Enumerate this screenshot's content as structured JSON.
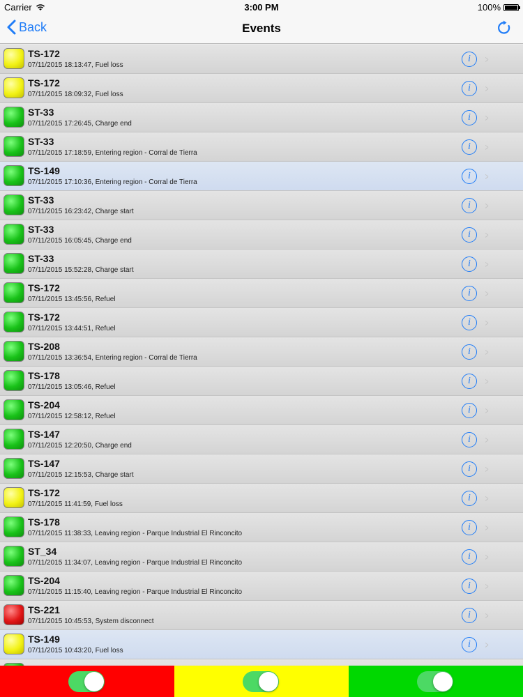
{
  "status_bar": {
    "carrier": "Carrier",
    "time": "3:00 PM",
    "battery": "100%"
  },
  "nav": {
    "back_label": "Back",
    "title": "Events",
    "accent_color": "#1f7cf7"
  },
  "events": [
    {
      "name": "TS-172",
      "detail": "07/11/2015 18:13:47, Fuel loss",
      "status": "yellow",
      "highlighted": false
    },
    {
      "name": "TS-172",
      "detail": "07/11/2015 18:09:32, Fuel loss",
      "status": "yellow",
      "highlighted": false
    },
    {
      "name": "ST-33",
      "detail": "07/11/2015 17:26:45, Charge end",
      "status": "green",
      "highlighted": false
    },
    {
      "name": "ST-33",
      "detail": "07/11/2015 17:18:59, Entering region - Corral de Tierra",
      "status": "green",
      "highlighted": false
    },
    {
      "name": "TS-149",
      "detail": "07/11/2015 17:10:36, Entering region - Corral de Tierra",
      "status": "green",
      "highlighted": true
    },
    {
      "name": "ST-33",
      "detail": "07/11/2015 16:23:42, Charge start",
      "status": "green",
      "highlighted": false
    },
    {
      "name": "ST-33",
      "detail": "07/11/2015 16:05:45, Charge end",
      "status": "green",
      "highlighted": false
    },
    {
      "name": "ST-33",
      "detail": "07/11/2015 15:52:28, Charge start",
      "status": "green",
      "highlighted": false
    },
    {
      "name": "TS-172",
      "detail": "07/11/2015 13:45:56, Refuel",
      "status": "green",
      "highlighted": false
    },
    {
      "name": "TS-172",
      "detail": "07/11/2015 13:44:51, Refuel",
      "status": "green",
      "highlighted": false
    },
    {
      "name": "TS-208",
      "detail": "07/11/2015 13:36:54, Entering region - Corral de Tierra",
      "status": "green",
      "highlighted": false
    },
    {
      "name": "TS-178",
      "detail": "07/11/2015 13:05:46, Refuel",
      "status": "green",
      "highlighted": false
    },
    {
      "name": "TS-204",
      "detail": "07/11/2015 12:58:12, Refuel",
      "status": "green",
      "highlighted": false
    },
    {
      "name": "TS-147",
      "detail": "07/11/2015 12:20:50, Charge end",
      "status": "green",
      "highlighted": false
    },
    {
      "name": "TS-147",
      "detail": "07/11/2015 12:15:53, Charge start",
      "status": "green",
      "highlighted": false
    },
    {
      "name": "TS-172",
      "detail": "07/11/2015 11:41:59, Fuel loss",
      "status": "yellow",
      "highlighted": false
    },
    {
      "name": "TS-178",
      "detail": "07/11/2015 11:38:33, Leaving region - Parque Industrial El Rinconcito",
      "status": "green",
      "highlighted": false
    },
    {
      "name": "ST_34",
      "detail": "07/11/2015 11:34:07, Leaving region - Parque Industrial El Rinconcito",
      "status": "green",
      "highlighted": false
    },
    {
      "name": "TS-204",
      "detail": "07/11/2015 11:15:40, Leaving region - Parque Industrial El Rinconcito",
      "status": "green",
      "highlighted": false
    },
    {
      "name": "TS-221",
      "detail": "07/11/2015 10:45:53, System disconnect",
      "status": "red",
      "highlighted": false
    },
    {
      "name": "TS-149",
      "detail": "07/11/2015 10:43:20, Fuel loss",
      "status": "yellow",
      "highlighted": true
    },
    {
      "name": "",
      "detail": "",
      "status": "green",
      "highlighted": false
    }
  ],
  "filters": [
    {
      "color": "red",
      "hex": "#ff0000",
      "enabled": true
    },
    {
      "color": "yellow",
      "hex": "#ffff00",
      "enabled": true
    },
    {
      "color": "green",
      "hex": "#00d800",
      "enabled": true
    }
  ]
}
